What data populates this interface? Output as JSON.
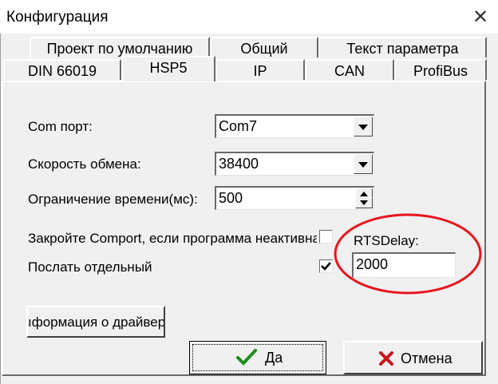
{
  "window": {
    "title": "Конфигурация",
    "close_glyph": "✕"
  },
  "tabs_row1": [
    {
      "label": "Проект по умолчанию"
    },
    {
      "label": "Общий"
    },
    {
      "label": "Текст параметра"
    }
  ],
  "tabs_row2": [
    {
      "label": "DIN 66019"
    },
    {
      "label": "HSP5",
      "active": true
    },
    {
      "label": "IP"
    },
    {
      "label": "CAN"
    },
    {
      "label": "ProfiBus"
    }
  ],
  "form": {
    "com_port": {
      "label": "Com порт:",
      "value": "Com7"
    },
    "baud_rate": {
      "label": "Скорость обмена:",
      "value": "38400"
    },
    "timeout": {
      "label": "Ограничение времени(мс):",
      "value": "500"
    },
    "close_comport": {
      "label": "Закройте Comport, если программа неактивна",
      "checked": false
    },
    "send_separate": {
      "label": "Послать отдельный",
      "checked": true
    },
    "rts_delay": {
      "label": "RTSDelay:",
      "value": "2000"
    },
    "driver_info_button": "ıформация о драйвер"
  },
  "buttons": {
    "ok": "Да",
    "cancel": "Отмена"
  },
  "colors": {
    "annotation": "#e8141c",
    "ok_check": "#1e8c1e",
    "cancel_x": "#c8141c"
  },
  "icons": {
    "ok": "check-icon",
    "cancel": "x-icon",
    "dropdown": "dropdown-arrow-icon",
    "spin": "spin-arrow-icon"
  }
}
